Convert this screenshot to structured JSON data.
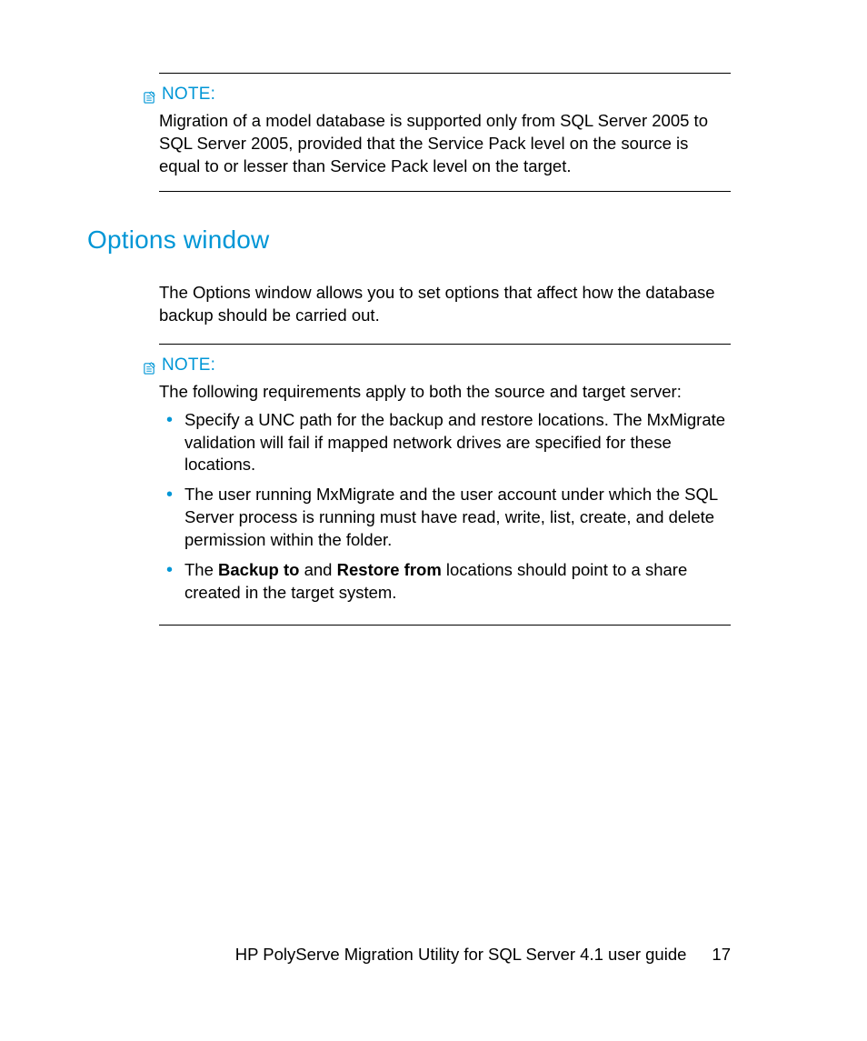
{
  "note1": {
    "label": "NOTE:",
    "body": "Migration of a model database is supported only from SQL Server 2005 to SQL Server 2005, provided that the Service Pack level on the source is equal to or lesser than Service Pack level on the target."
  },
  "section": {
    "heading": "Options window",
    "intro": "The Options window allows you to set options that affect how the database backup should be carried out."
  },
  "note2": {
    "label": "NOTE:",
    "lead": "The following requirements apply to both the source and target server:",
    "bullets": {
      "b1": "Specify a UNC path for the backup and restore locations. The MxMigrate validation will fail if mapped network drives are specified for these locations.",
      "b2": "The user running MxMigrate and the user account under which the SQL Server process is running must have read, write, list, create, and delete permission within the folder.",
      "b3_pre": "The ",
      "b3_bold1": "Backup to",
      "b3_mid": " and ",
      "b3_bold2": "Restore from",
      "b3_post": " locations should point to a share created in the target system."
    }
  },
  "footer": {
    "title": "HP PolyServe Migration Utility for SQL Server 4.1 user guide",
    "page": "17"
  }
}
